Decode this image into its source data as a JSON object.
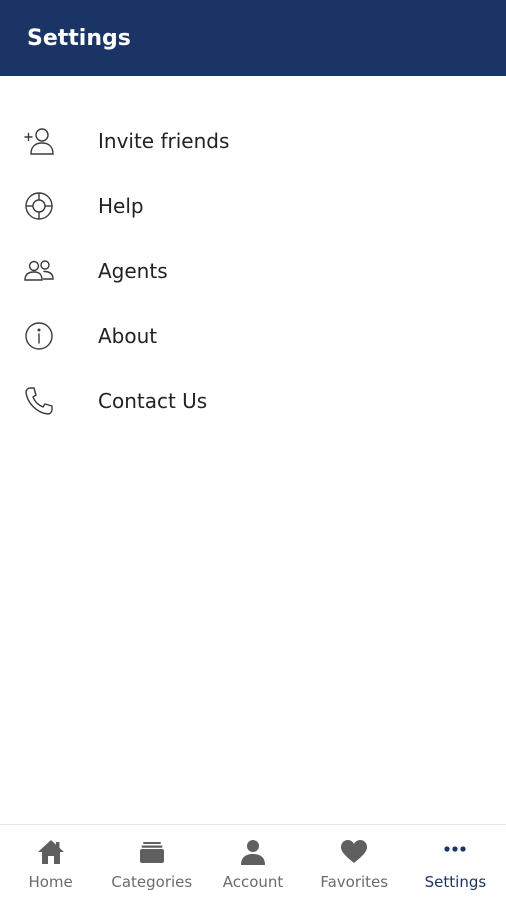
{
  "header": {
    "title": "Settings",
    "background": "#1b3466"
  },
  "menu": {
    "items": [
      {
        "label": "Invite friends",
        "icon": "add-person-icon"
      },
      {
        "label": "Help",
        "icon": "lifebuoy-icon"
      },
      {
        "label": "Agents",
        "icon": "people-icon"
      },
      {
        "label": "About",
        "icon": "info-icon"
      },
      {
        "label": "Contact Us",
        "icon": "phone-icon"
      }
    ]
  },
  "tabbar": {
    "tabs": [
      {
        "label": "Home",
        "icon": "home-icon"
      },
      {
        "label": "Categories",
        "icon": "categories-icon"
      },
      {
        "label": "Account",
        "icon": "account-icon"
      },
      {
        "label": "Favorites",
        "icon": "heart-icon"
      },
      {
        "label": "Settings",
        "icon": "more-dots-icon",
        "active": true
      }
    ],
    "inactive_color": "#6b6b6b",
    "active_color": "#1b3466"
  }
}
